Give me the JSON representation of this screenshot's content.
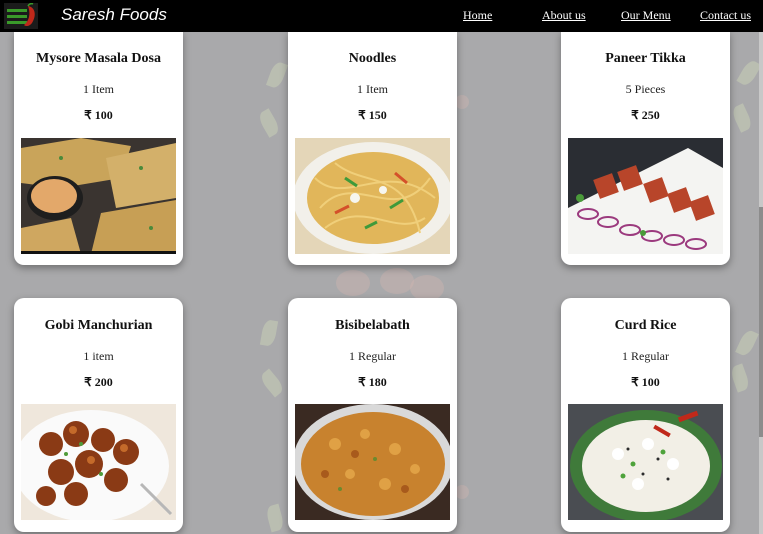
{
  "brand": {
    "name": "Saresh Foods"
  },
  "nav": {
    "links": [
      "Home",
      "About us",
      "Our Menu",
      "Contact us"
    ]
  },
  "menu": {
    "items": [
      {
        "name": "Mysore Masala Dosa",
        "quantity": "1 Item",
        "price": "₹ 100"
      },
      {
        "name": "Noodles",
        "quantity": "1 Item",
        "price": "₹ 150"
      },
      {
        "name": "Paneer Tikka",
        "quantity": "5 Pieces",
        "price": "₹ 250"
      },
      {
        "name": "Gobi Manchurian",
        "quantity": "1 item",
        "price": "₹ 200"
      },
      {
        "name": "Bisibelabath",
        "quantity": "1 Regular",
        "price": "₹ 180"
      },
      {
        "name": "Curd Rice",
        "quantity": "1 Regular",
        "price": "₹ 100"
      }
    ]
  },
  "colors": {
    "navbar": "#000000",
    "page_background": "#a9a9ab",
    "card": "#ffffff"
  }
}
